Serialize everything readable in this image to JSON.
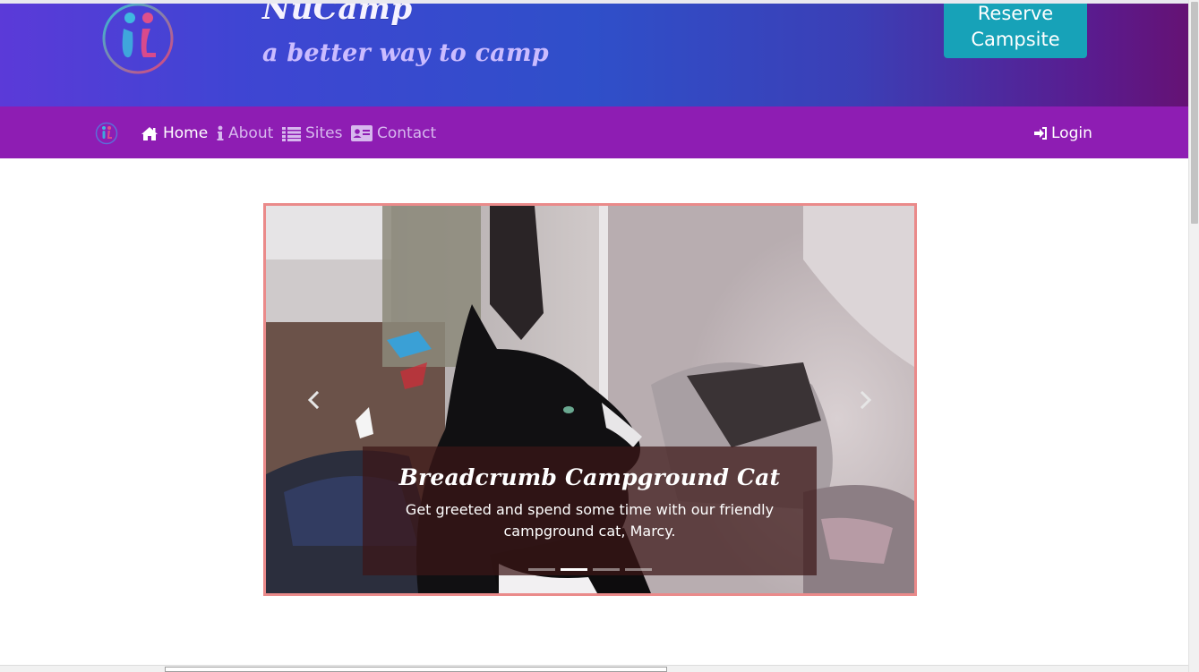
{
  "header": {
    "brand_title": "NuCamp",
    "tagline": "a better way to camp",
    "reserve_button": "Reserve Campsite"
  },
  "nav": {
    "items": [
      {
        "label": "Home",
        "icon": "home-icon",
        "active": true
      },
      {
        "label": "About",
        "icon": "info-icon",
        "active": false
      },
      {
        "label": "Sites",
        "icon": "list-icon",
        "active": false
      },
      {
        "label": "Contact",
        "icon": "address-card-icon",
        "active": false
      }
    ],
    "login": {
      "label": "Login",
      "icon": "sign-in-icon"
    }
  },
  "carousel": {
    "caption_title": "Breadcrumb Campground Cat",
    "caption_text": "Get greeted and spend some time with our friendly campground cat, Marcy.",
    "slide_count": 4,
    "active_slide": 1
  },
  "colors": {
    "navbar": "#8e1db3",
    "reserve_button": "#17a2b8",
    "carousel_border": "#ea8a8a",
    "header_gradient_start": "#5b3ad8",
    "header_gradient_end": "#651274"
  }
}
